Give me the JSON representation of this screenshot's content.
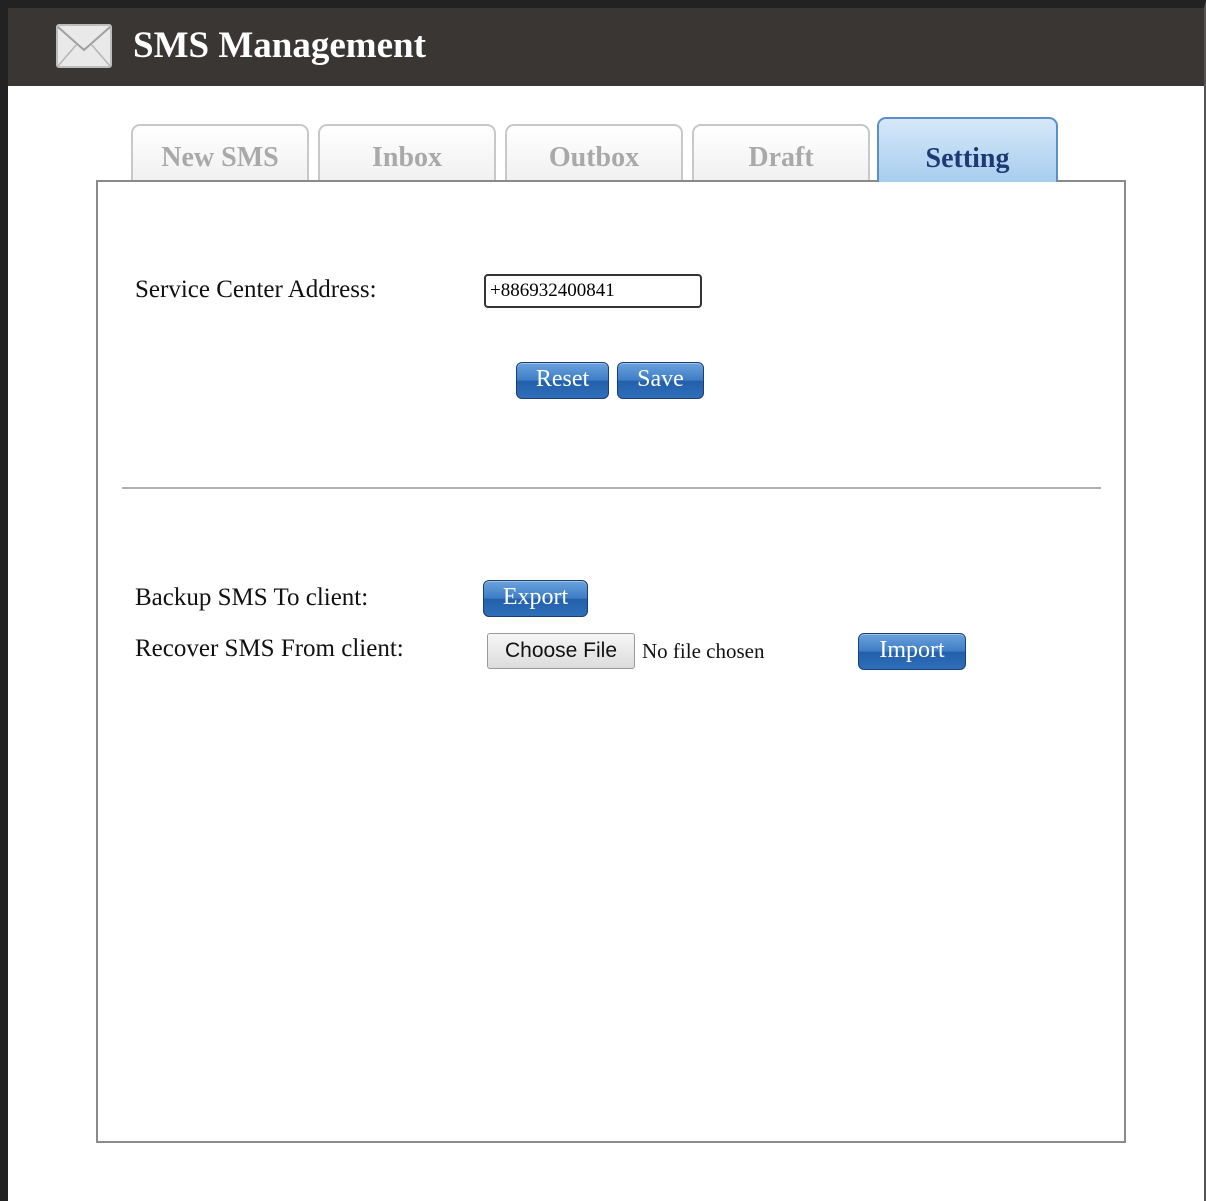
{
  "header": {
    "title": "SMS Management",
    "icon": "envelope-icon"
  },
  "tabs": [
    {
      "label": "New SMS",
      "active": false
    },
    {
      "label": "Inbox",
      "active": false
    },
    {
      "label": "Outbox",
      "active": false
    },
    {
      "label": "Draft",
      "active": false
    },
    {
      "label": "Setting",
      "active": true
    }
  ],
  "settings": {
    "service_center_label": "Service Center Address:",
    "service_center_value": "+886932400841",
    "reset_label": "Reset",
    "save_label": "Save"
  },
  "backup": {
    "export_label_text": "Backup SMS To client:",
    "export_button": "Export",
    "recover_label_text": "Recover SMS From client:",
    "choose_file_button": "Choose File",
    "file_status": "No file chosen",
    "import_button": "Import"
  },
  "colors": {
    "titlebar": "#3a3634",
    "button_blue": "#2f6eb9",
    "active_tab": "#a7cdef",
    "active_tab_text": "#1d3a74",
    "inactive_tab_text": "#a9a9a9"
  }
}
